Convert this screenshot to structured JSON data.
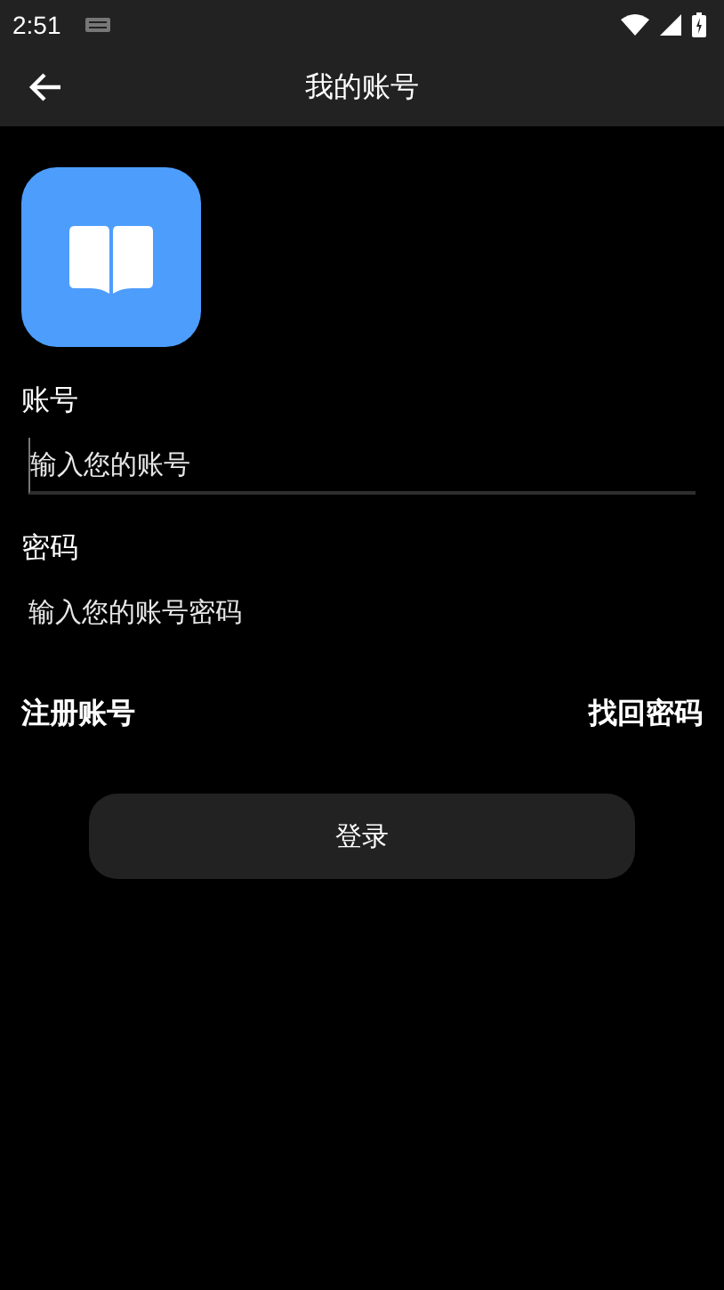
{
  "status_bar": {
    "time": "2:51"
  },
  "app_bar": {
    "title": "我的账号"
  },
  "fields": [
    {
      "label": "账号",
      "placeholder": "输入您的账号",
      "focused": true
    },
    {
      "label": "密码",
      "placeholder": "输入您的账号密码",
      "focused": false
    }
  ],
  "links": [
    "注册账号",
    "找回密码"
  ],
  "login_button": "登录"
}
